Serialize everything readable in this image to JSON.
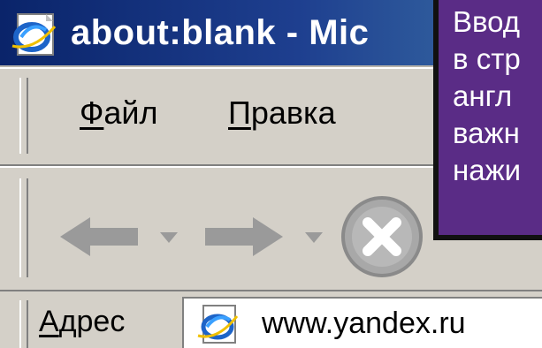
{
  "window": {
    "title": "about:blank - Mic",
    "icon": "ie-page-icon"
  },
  "menu": {
    "items": [
      {
        "hotkey": "Ф",
        "rest": "айл"
      },
      {
        "hotkey": "П",
        "rest": "равка"
      }
    ]
  },
  "toolbar": {
    "buttons": [
      "back-arrow-icon",
      "dropdown-arrow-icon",
      "forward-arrow-icon",
      "dropdown-arrow-icon",
      "stop-icon"
    ]
  },
  "address": {
    "label_hotkey": "А",
    "label_rest": "дрес",
    "value": "www.yandex.ru",
    "icon": "ie-page-icon"
  },
  "callout": {
    "lines": [
      "Ввод",
      "в стр",
      "англ",
      "важн",
      "нажи"
    ],
    "background": "#5a2c86",
    "text_color": "#ffffff"
  },
  "colors": {
    "titlebar": "#0a246a",
    "chrome": "#d4d0c8"
  }
}
